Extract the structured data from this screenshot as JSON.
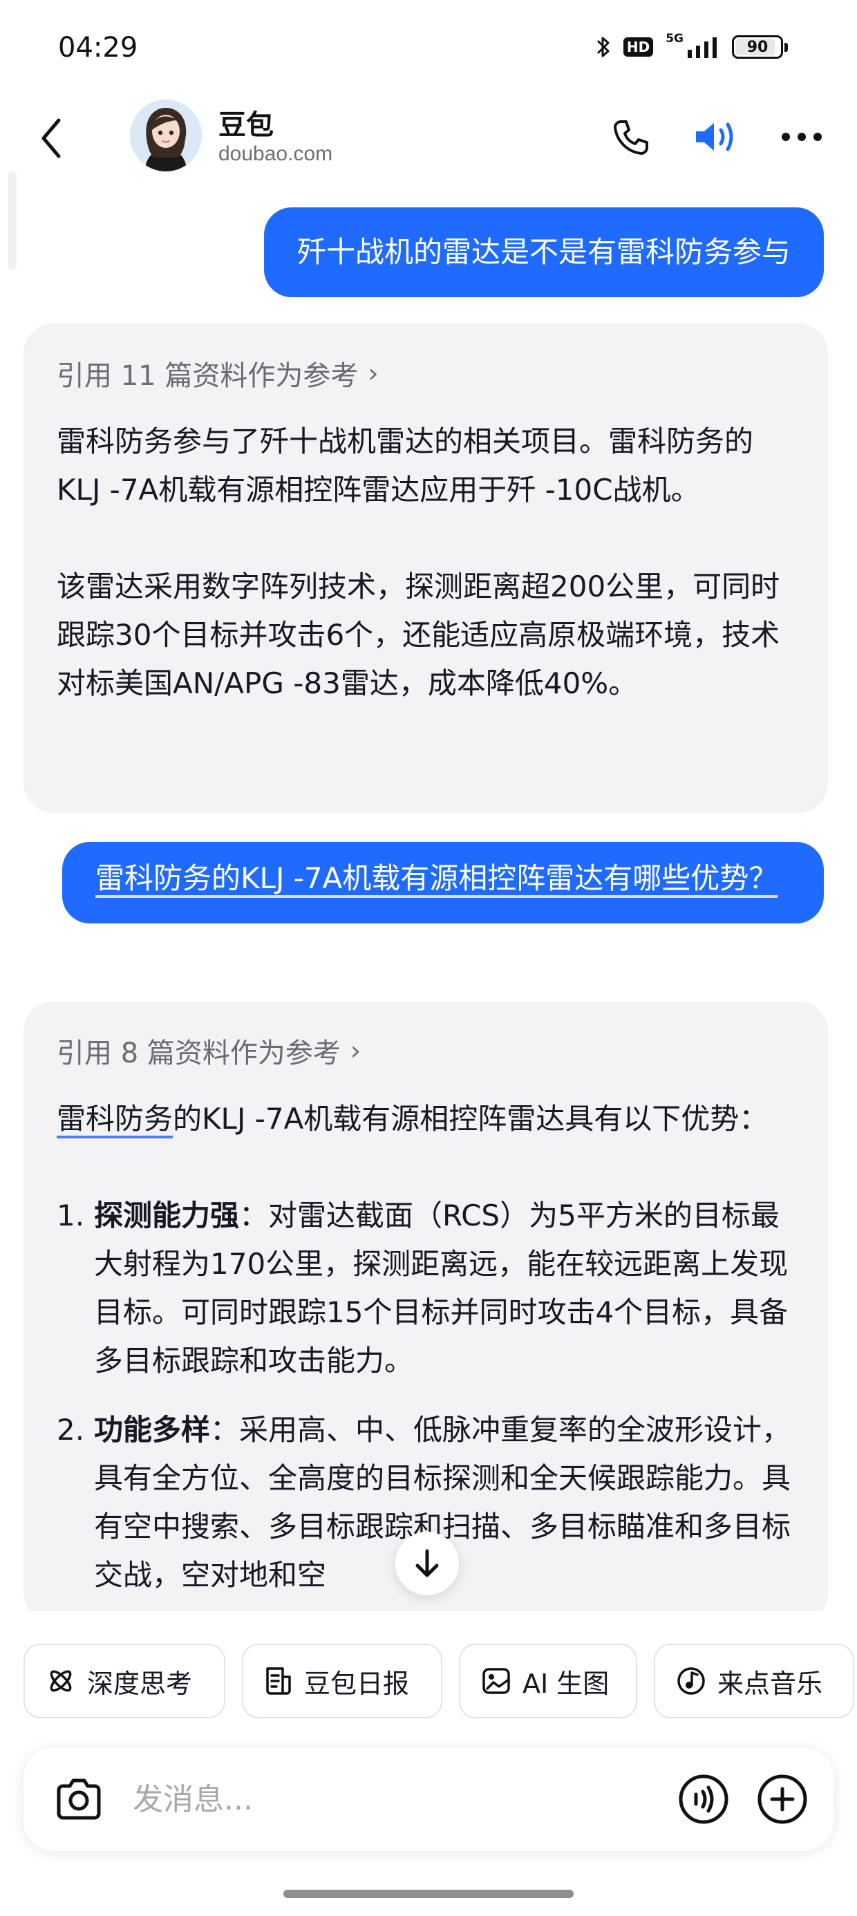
{
  "status_bar": {
    "time": "04:29",
    "network": "5G",
    "hd": "HD",
    "battery": "90",
    "battery_level": 0.9
  },
  "header": {
    "name": "豆包",
    "domain": "doubao.com"
  },
  "messages": {
    "user1": "歼十战机的雷达是不是有雷科防务参与",
    "bot1": {
      "ref": "引用 11 篇资料作为参考",
      "p1": "雷科防务参与了歼十战机雷达的相关项目。雷科防务的KLJ -7A机载有源相控阵雷达应用于歼 -10C战机。",
      "p2": "该雷达采用数字阵列技术，探测距离超200公里，可同时跟踪30个目标并攻击6个，还能适应高原极端环境，技术对标美国AN/APG -83雷达，成本降低40%。"
    },
    "user2": "雷科防务的KLJ -7A机载有源相控阵雷达有哪些优势？",
    "bot2": {
      "ref": "引用 8 篇资料作为参考",
      "intro_head": "雷科防务",
      "intro_rest": "的KLJ -7A机载有源相控阵雷达具有以下优势：",
      "items": [
        {
          "num": "1.",
          "title": "探测能力强",
          "text": "：对雷达截面（RCS）为5平方米的目标最大射程为170公里，探测距离远，能在较远距离上发现目标。可同时跟踪15个目标并同时攻击4个目标，具备多目标跟踪和攻击能力。"
        },
        {
          "num": "2.",
          "title": "功能多样",
          "text": "：采用高、中、低脉冲重复率的全波形设计，具有全方位、全高度的目标探测和全天候跟踪能力。具有空中搜索、多目标跟踪和扫描、多目标瞄准和多目标交战，空对地和空"
        }
      ]
    }
  },
  "chips": [
    "深度思考",
    "豆包日报",
    "AI 生图",
    "来点音乐"
  ],
  "input": {
    "placeholder": "发消息..."
  },
  "colors": {
    "accent": "#1f6bff",
    "bubble_bot": "#f3f3f5",
    "speaker": "#1f6bff"
  }
}
